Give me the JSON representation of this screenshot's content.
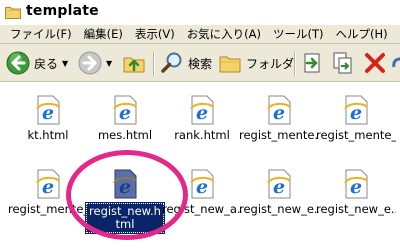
{
  "window": {
    "title": "template"
  },
  "menu": [
    {
      "label": "ファイル(F)"
    },
    {
      "label": "編集(E)"
    },
    {
      "label": "表示(V)"
    },
    {
      "label": "お気に入り(A)"
    },
    {
      "label": "ツール(T)"
    },
    {
      "label": "ヘルプ(H)"
    }
  ],
  "toolbar": {
    "back_label": "戻る",
    "search_label": "検索",
    "folders_label": "フォルダ"
  },
  "files_row1": [
    {
      "name": "kt.html"
    },
    {
      "name": "mes.html"
    },
    {
      "name": "rank.html"
    },
    {
      "name": "regist_mente..."
    },
    {
      "name": "regist_mente_..."
    }
  ],
  "files_row2": [
    {
      "name": "regist_mente_..."
    },
    {
      "name": "regist_new.html",
      "selected": true
    },
    {
      "name": "regist_new_a..."
    },
    {
      "name": "regist_new_e..."
    },
    {
      "name": "regist_new_e..."
    }
  ],
  "colors": {
    "selection": "#0a246a",
    "highlight_ring": "#e4288a",
    "chrome": "#ece9d8"
  }
}
